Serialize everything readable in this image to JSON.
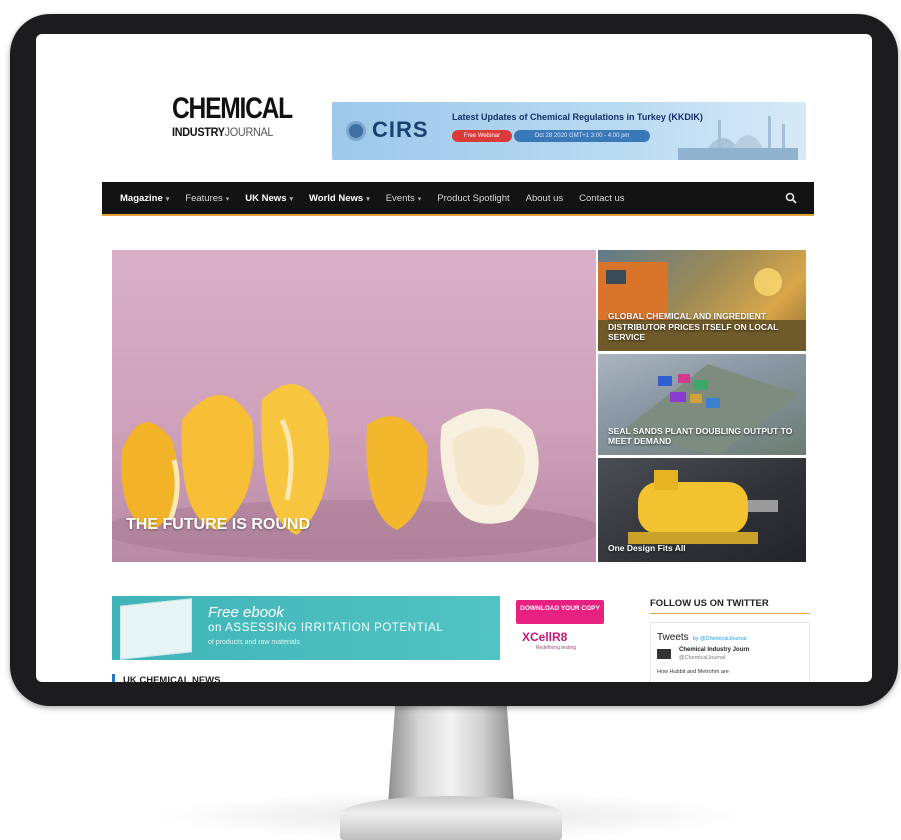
{
  "logo": {
    "line1": "CHEMICAL",
    "line2_bold": "INDUSTRY",
    "line2_thin": "JOURNAL"
  },
  "ad": {
    "brand": "CIRS",
    "headline": "Latest Updates of Chemical Regulations in Turkey (KKDIK)",
    "pill": "Free Webinar",
    "date": "Oct 28 2020 GMT+1 3:00 - 4:00 pm"
  },
  "nav": {
    "items": [
      {
        "label": "Magazine",
        "has_caret": true,
        "bold": true
      },
      {
        "label": "Features",
        "has_caret": true,
        "bold": false
      },
      {
        "label": "UK News",
        "has_caret": true,
        "bold": true
      },
      {
        "label": "World News",
        "has_caret": true,
        "bold": true
      },
      {
        "label": "Events",
        "has_caret": true,
        "bold": false
      },
      {
        "label": "Product Spotlight",
        "has_caret": false,
        "bold": false
      },
      {
        "label": "About us",
        "has_caret": false,
        "bold": false
      },
      {
        "label": "Contact us",
        "has_caret": false,
        "bold": false
      }
    ],
    "caret": "▾",
    "search_icon": "search-icon"
  },
  "featured": {
    "hero_title": "THE FUTURE IS ROUND",
    "cards": [
      {
        "title": "GLOBAL CHEMICAL AND INGREDIENT DISTRIBUTOR PRICES ITSELF ON LOCAL SERVICE"
      },
      {
        "title": "SEAL SANDS PLANT DOUBLING OUTPUT TO MEET DEMAND"
      },
      {
        "title": "One Design Fits All"
      }
    ]
  },
  "ebook": {
    "line1": "Free ebook",
    "line2": "on ASSESSING IRRITATION POTENTIAL",
    "line3": "of products and raw materials"
  },
  "download": {
    "label": "DOWNLOAD YOUR COPY",
    "brand": "XCellR8",
    "tag": "Redefining testing"
  },
  "twitter": {
    "heading": "FOLLOW US ON TWITTER",
    "tweets_title": "Tweets",
    "tweets_by": "by @ChemicalJournal",
    "tweet_name": "Chemical Industry Journ",
    "tweet_handle": "@ChemicalJournal",
    "tweet_text": "How Hubbit and Metrohm are"
  },
  "sections": {
    "uk_news": "UK CHEMICAL NEWS"
  },
  "colors": {
    "nav_bg": "#131313",
    "nav_accent": "#e6a23c",
    "hero_bg": "#d4a8c0",
    "ebook_bg": "#46b9bc",
    "download_bg": "#e6217f",
    "section_accent": "#2a76c6"
  }
}
